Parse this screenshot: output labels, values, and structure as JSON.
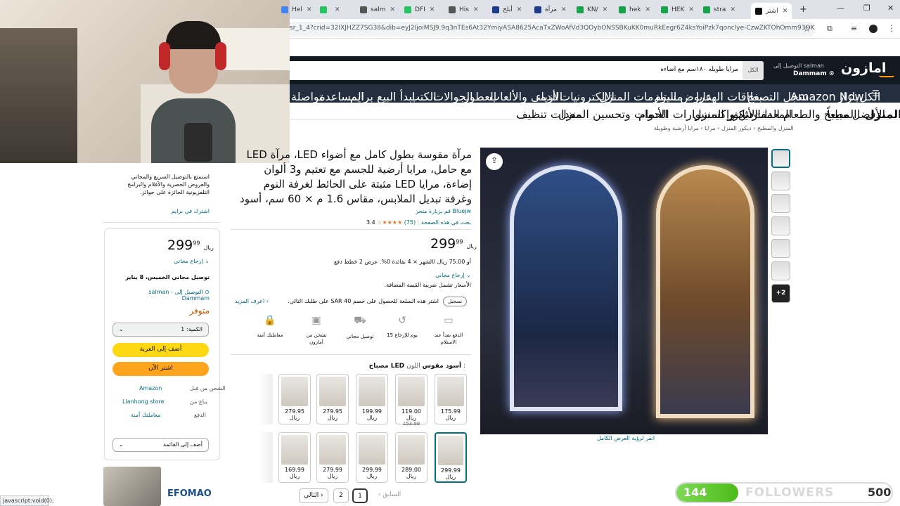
{
  "browser": {
    "tabs": [
      {
        "label": "Hel",
        "color": "#4285f4"
      },
      {
        "label": "",
        "color": "#22c55e"
      },
      {
        "label": "salm",
        "color": "#555555"
      },
      {
        "label": "DFI",
        "color": "#22c55e"
      },
      {
        "label": "His",
        "color": "#555555"
      },
      {
        "label": "أبلج",
        "color": "#1e3a8a"
      },
      {
        "label": "مرآة",
        "color": "#1e3a8a"
      },
      {
        "label": "KN/",
        "color": "#16a34a"
      },
      {
        "label": "hek",
        "color": "#16a34a"
      },
      {
        "label": "HEK",
        "color": "#16a34a"
      },
      {
        "label": "stra",
        "color": "#16a34a"
      },
      {
        "label": "اشتر",
        "color": "#111111"
      }
    ],
    "url": "sr_1_4?crid=32IXJHZZ7SG38&dib=eyJ2IjoiMSJ9.9q3nTEs6At32YmiyASA8625AcaTxZWoAfVd3QOybONSSBKuKK0muRkEegr6Z4ksYoiPzk7qonclye-CzwZKTOhOmm93OK7sUdb...",
    "status_url": "javascript:void(0);"
  },
  "header": {
    "logo": "امازون",
    "deliver_line1": "التوصيل إلى salman",
    "deliver_line2": "Dammam",
    "search_category": "الكل",
    "search_text": "مرايا طويله ١٨٠سم مع اضاءه"
  },
  "nav_main": [
    "الكل",
    "بازار",
    "Amazon Now",
    "سجل التصفح",
    "بطاقات الهدايا",
    "عروض اليوم",
    "مستلزمات المنزل",
    "الإلكترونيات",
    "الأزياء",
    "الدمى والألعاب",
    "العطور",
    "الجوالات",
    "الكتب",
    "ابدأ البيع",
    "برايم",
    "المساعدة",
    "مواصلة"
  ],
  "nav_sub": [
    "المنزل",
    "الأفضل مبيعاً",
    "المطبخ والطعام",
    "المعدات",
    "الأثاث",
    "ديكور المنزل",
    "المفارش وإكسسوارات الحمام",
    "الأدوات وتحسين المنزل",
    "معدات تنظيف"
  ],
  "breadcrumb": "المنزل والمطبخ › ديكور المنزل › مرايا › مرايا أرضية وطويلة",
  "product": {
    "title": "مرآة مقوسة بطول كامل مع أضواء LED، مرآة LED مع حامل، مرايا أرضية للجسم مع تعتيم و3 ألوان إضاءة، مرايا LED مثبتة على الحائط لغرفة النوم وغرفة تبديل الملابس، مقاس 1.6 م × 60 سم، أسود",
    "store_link": "قم بزيارة متجر Bluejw",
    "rating": "3.4",
    "stars": "★★★★☆",
    "rating_count": "(75)",
    "search_page_link": "بحث في هذه الصفحة",
    "price_whole": "299",
    "price_fraction": "99",
    "currency": "ريال",
    "installment": "أو 75.00 ريال /الشهر × 4 بفائدة 0%. عرض 2 خطط دفع",
    "returns": "إرجاع مجاني",
    "vat_note": "الأسعار تشمل ضريبة القيمة المضافة.",
    "coupon_tag": "تسجيل",
    "coupon_text": "اشتر هذه السلعة للحصول على خصم 40 SAR على طلبك التالي.",
    "coupon_more": "اعرف المزيد",
    "color_label": "اللون :",
    "color_value": "مصباح LED أسود مقوس",
    "full_view": "انقر لرؤية العرض الكامل"
  },
  "features": [
    {
      "icon": "cash-icon",
      "label": "الدفع نقداً عند الاستلام"
    },
    {
      "icon": "return-icon",
      "label": "15 يوم للإرجاع"
    },
    {
      "icon": "truck-icon",
      "label": "توصيل مجاني"
    },
    {
      "icon": "box-icon",
      "label": "تشحن من أمازون"
    },
    {
      "icon": "lock-icon",
      "label": "معاملتك آمنة"
    }
  ],
  "variants_row1": [
    {
      "price": "175.99 ريال",
      "old": ""
    },
    {
      "price": "119.00 ريال",
      "old": "153.99"
    },
    {
      "price": "199.99 ريال",
      "old": ""
    },
    {
      "price": "279.95 ريال",
      "old": ""
    },
    {
      "price": "279.95 ريال",
      "old": ""
    }
  ],
  "variants_row2": [
    {
      "price": "299.99 ريال",
      "old": ""
    },
    {
      "price": "289.00 ريال",
      "old": ""
    },
    {
      "price": "299.99 ريال",
      "old": ""
    },
    {
      "price": "279.99 ريال",
      "old": ""
    },
    {
      "price": "169.99 ريال",
      "old": ""
    }
  ],
  "pagination": {
    "prev": "السابق",
    "page1": "1",
    "page2": "2",
    "next": "التالي"
  },
  "prime_promo": {
    "text": "استمتع بالتوصيل السريع والمجاني والعروض الحصرية والأفلام والبرامج التلفزيونية الحائزة على جوائز.",
    "link": "اشترك في برايم"
  },
  "buybox": {
    "price_whole": "299",
    "price_fraction": "99",
    "currency": "ريال",
    "returns": "إرجاع مجاني",
    "delivery": "توصيل مجاني الخميس، 8 يناير",
    "deliver_to": "التوصيل إلى salman - Dammam",
    "availability": "متوفر",
    "qty_label": "الكمية: 1",
    "add_to_cart": "أضف إلى العربة",
    "buy_now": "اشتر الآن",
    "ships_from_label": "الشحن من قبل",
    "ships_from": "Amazon",
    "sold_by_label": "يباع من",
    "sold_by": "Llanhong store",
    "payment_label": "الدفع",
    "payment": "معاملتك آمنة",
    "add_to_list": "أضف إلى القائمة"
  },
  "ad_brand": "EFOMAO",
  "followers": {
    "current": "144",
    "label": "FOLLOWERS",
    "goal": "500",
    "progress": 0.288
  }
}
